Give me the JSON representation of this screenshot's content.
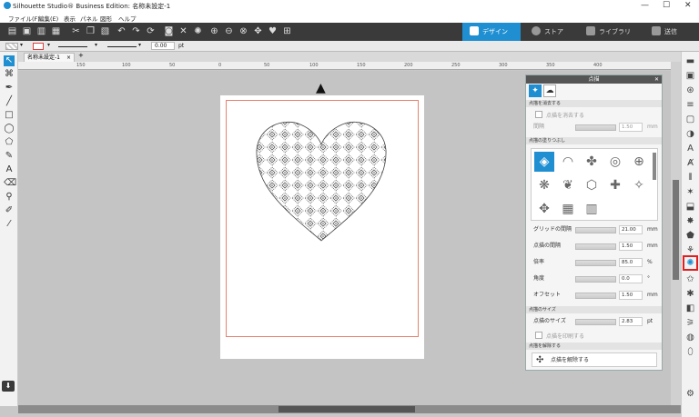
{
  "window": {
    "title": "Silhouette Studio® Business Edition: 名称未設定-1",
    "min": "—",
    "max": "☐",
    "close": "✕"
  },
  "menu": [
    "ファイル(F)",
    "編集(E)",
    "表示",
    "パネル",
    "図形",
    "ヘルプ"
  ],
  "tabs": [
    {
      "label": "デザイン",
      "color": "#1f8fd1",
      "active": true
    },
    {
      "label": "ストア",
      "color": "#888",
      "active": false
    },
    {
      "label": "ライブラリ",
      "color": "#888",
      "active": false
    },
    {
      "label": "送信",
      "color": "#888",
      "active": false
    }
  ],
  "linebar": {
    "width_value": "0.00",
    "width_unit": "pt"
  },
  "doc": {
    "tab_name": "名称未設定-1",
    "close": "×",
    "add": "+"
  },
  "ruler": [
    "150",
    "100",
    "50",
    "0",
    "50",
    "100",
    "150",
    "200",
    "250",
    "300",
    "350",
    "400"
  ],
  "panel": {
    "title": "点描",
    "close": "✕",
    "sec_clear": "点描を消去する",
    "clear_check_label": "点描を消去する",
    "spacing_label": "間隔",
    "spacing_value": "1.50",
    "spacing_unit": "mm",
    "sec_type": "点描の塗りつぶし",
    "grid_spacing_label": "グリッドの間隔",
    "grid_spacing_value": "21.00",
    "grid_spacing_unit": "mm",
    "dot_spacing_label": "点描の間隔",
    "dot_spacing_value": "1.50",
    "dot_spacing_unit": "mm",
    "scale_label": "倍率",
    "scale_value": "85.0",
    "scale_unit": "%",
    "angle_label": "角度",
    "angle_value": "0.0",
    "angle_unit": "°",
    "offset_label": "オフセット",
    "offset_value": "1.50",
    "offset_unit": "mm",
    "sec_size": "点描のサイズ",
    "size_label": "点描のサイズ",
    "size_value": "2.83",
    "size_unit": "pt",
    "print_label": "点描を印刷する",
    "sec_release": "点描を解除する",
    "release_label": "点描を解除する"
  }
}
